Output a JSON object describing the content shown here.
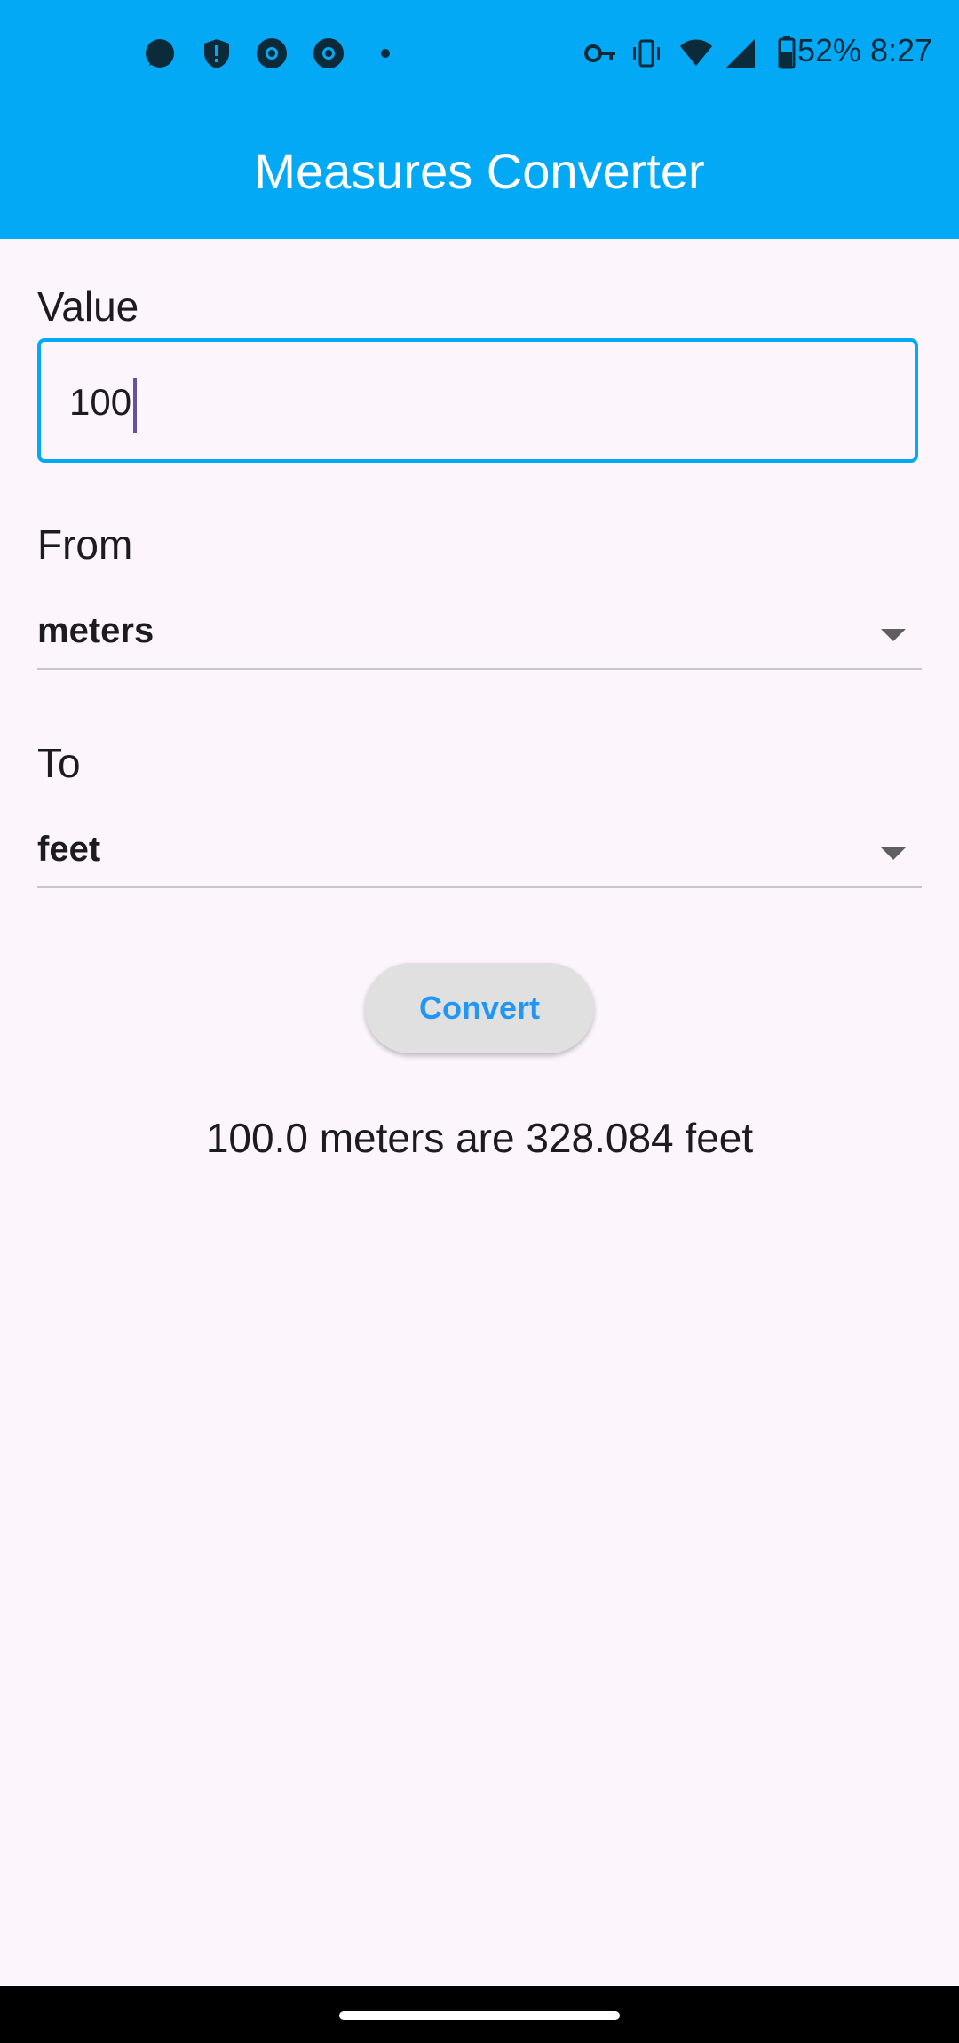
{
  "status_bar": {
    "battery": "52%",
    "time": "8:27",
    "icons_left": [
      "signal-messenger-icon",
      "shield-icon",
      "chrome-icon",
      "chrome-icon",
      "dot-icon"
    ],
    "icons_right": [
      "vpn-key-icon",
      "vibrate-icon",
      "wifi-icon",
      "cell-signal-icon",
      "battery-icon"
    ]
  },
  "app_bar": {
    "title": "Measures Converter",
    "color": "#03A9F4"
  },
  "form": {
    "value_label": "Value",
    "value_input": "100",
    "from_label": "From",
    "from_selected": "meters",
    "to_label": "To",
    "to_selected": "feet",
    "convert_label": "Convert"
  },
  "result": {
    "text": "100.0 meters are 328.084 feet"
  }
}
